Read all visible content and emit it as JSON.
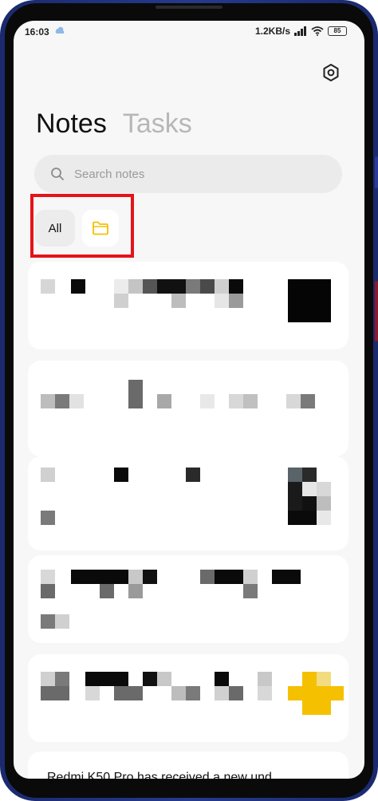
{
  "status_bar": {
    "time": "16:03",
    "net_speed": "1.2KB/s",
    "battery": "85"
  },
  "header": {
    "tabs": [
      {
        "label": "Notes",
        "active": true
      },
      {
        "label": "Tasks",
        "active": false
      }
    ]
  },
  "search": {
    "placeholder": "Search notes"
  },
  "filters": {
    "all_label": "All"
  },
  "notes_list": {
    "last_item_preview": "Redmi K50 Pro has received a new und"
  },
  "colors": {
    "accent_yellow": "#f5c000",
    "highlight_red": "#e3141a",
    "background": "#f7f7f7"
  },
  "icons": [
    "cloud-icon",
    "signal-icon",
    "wifi-icon",
    "battery-icon",
    "gear-icon",
    "search-icon",
    "folder-icon"
  ]
}
